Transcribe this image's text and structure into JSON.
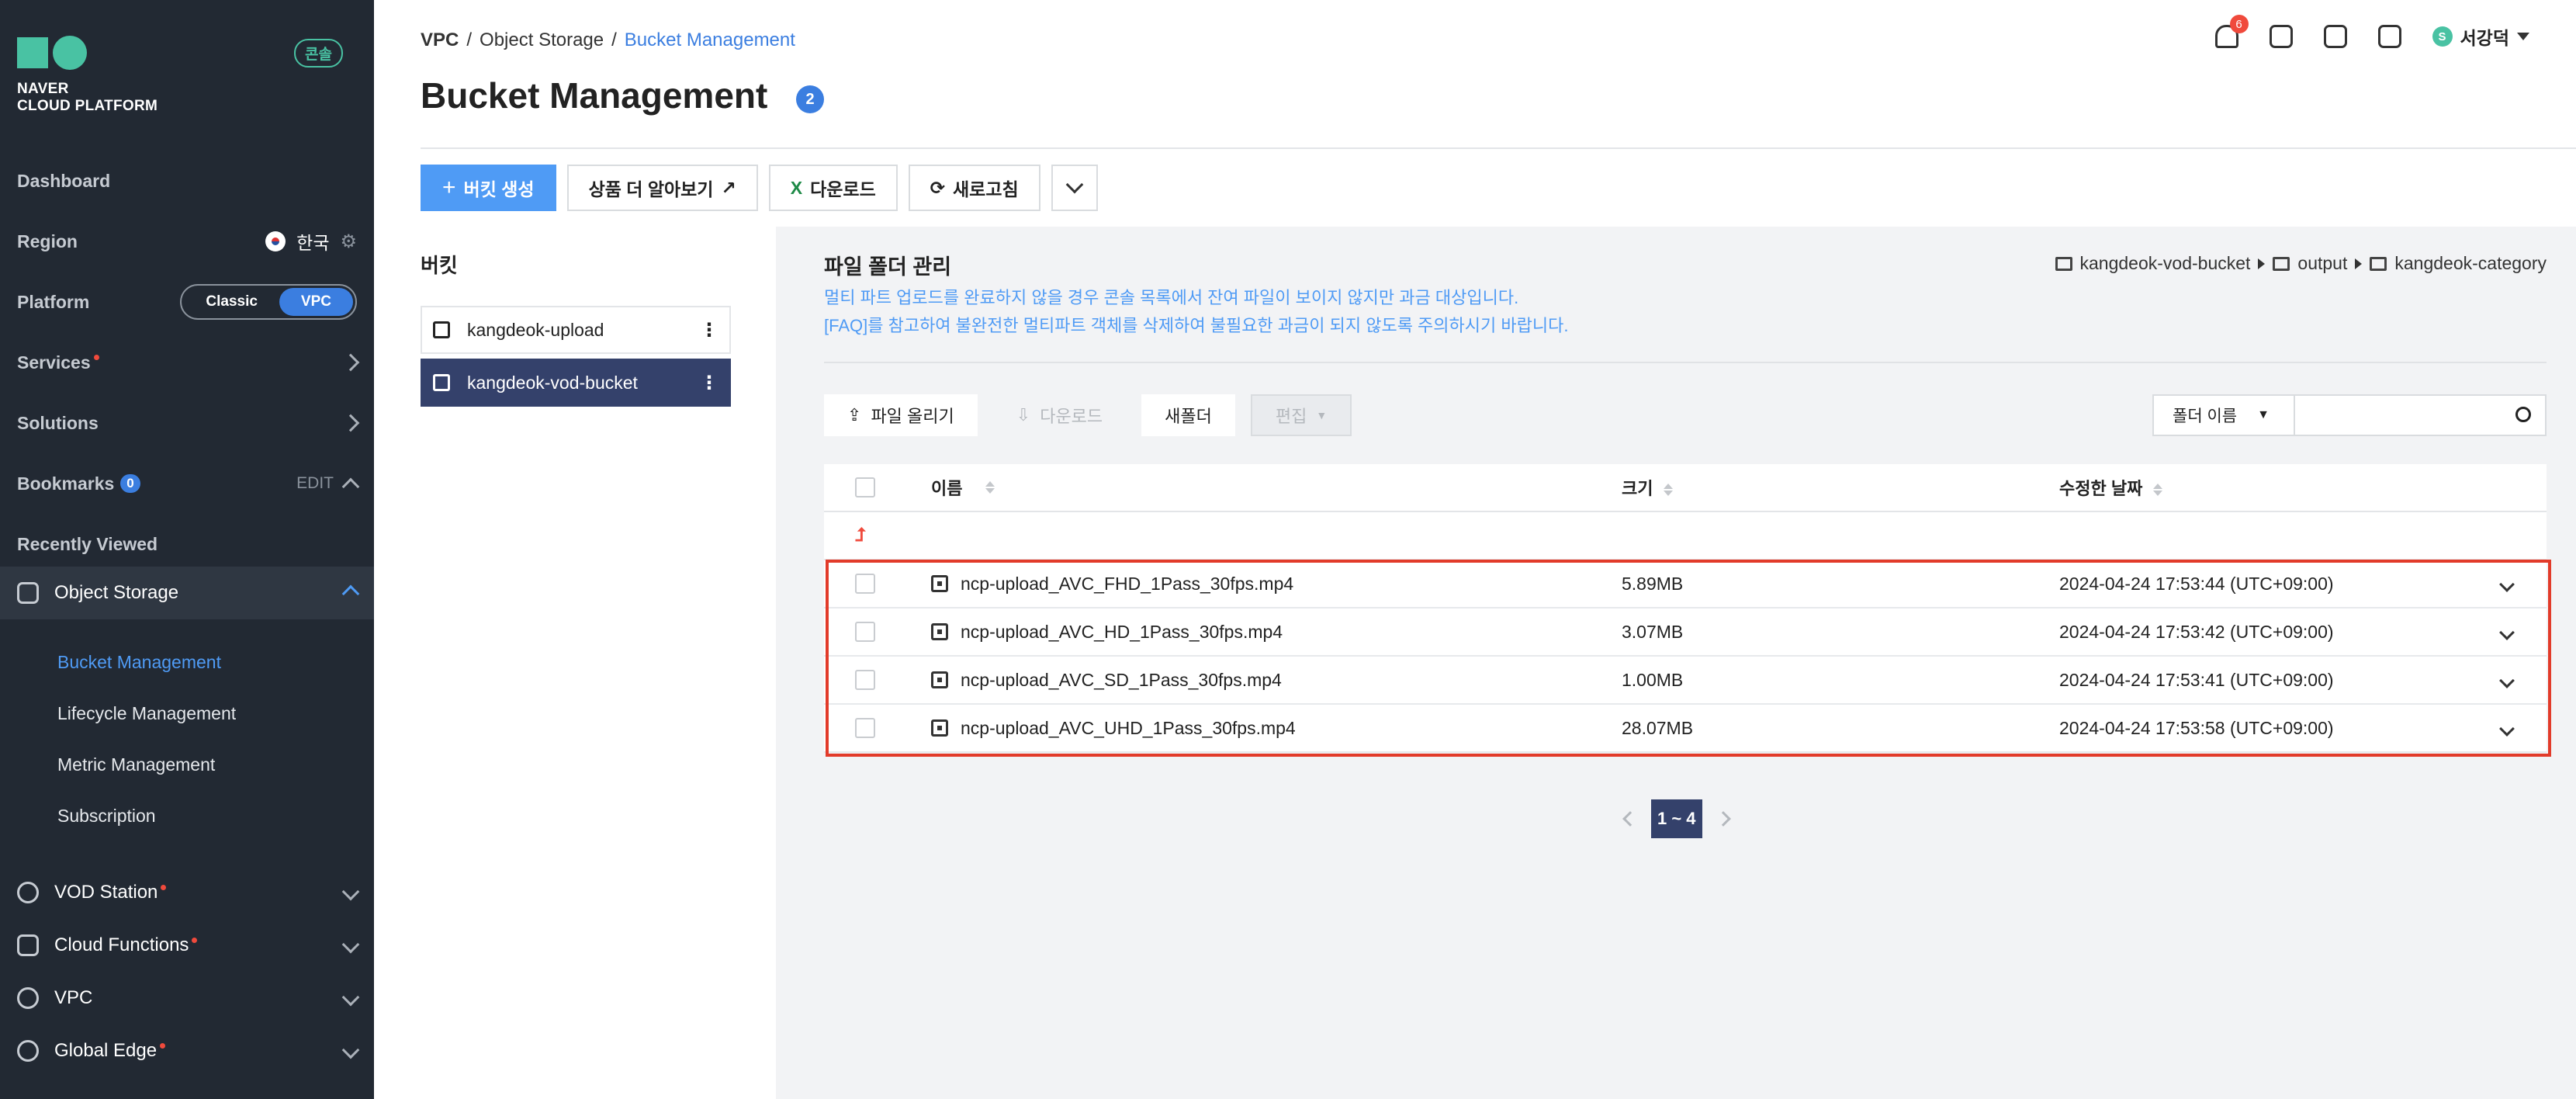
{
  "brand": {
    "line1": "NAVER",
    "line2": "CLOUD PLATFORM",
    "console_badge": "콘솔",
    "accent": "#49c2a3"
  },
  "sidebar": {
    "dashboard": "Dashboard",
    "region_label": "Region",
    "region_value": "한국",
    "platform_label": "Platform",
    "platform_options": [
      "Classic",
      "VPC"
    ],
    "platform_selected": "VPC",
    "services": "Services",
    "solutions": "Solutions",
    "bookmarks": "Bookmarks",
    "bookmarks_count": "0",
    "bookmarks_edit": "EDIT",
    "recently_viewed": "Recently Viewed",
    "active_section": "Object Storage",
    "sub_items": [
      "Bucket Management",
      "Lifecycle Management",
      "Metric Management",
      "Subscription"
    ],
    "bottom_items": [
      "VOD Station",
      "Cloud Functions",
      "VPC",
      "Global Edge"
    ]
  },
  "header": {
    "breadcrumb": [
      "VPC",
      "Object Storage",
      "Bucket Management"
    ],
    "title": "Bucket Management",
    "title_badge": "2",
    "notification_count": "6",
    "user_initial": "S",
    "user_name": "서강덕"
  },
  "toolbar": {
    "create": "버킷 생성",
    "learn_more": "상품 더 알아보기",
    "download": "다운로드",
    "refresh": "새로고침"
  },
  "buckets": {
    "heading": "버킷",
    "items": [
      "kangdeok-upload",
      "kangdeok-vod-bucket"
    ],
    "selected": "kangdeok-vod-bucket"
  },
  "files": {
    "title": "파일 폴더 관리",
    "notice1": "멀티 파트 업로드를 완료하지 않을 경우 콘솔 목록에서 잔여 파일이 보이지 않지만 과금 대상입니다.",
    "notice2": "[FAQ]를 참고하여 불완전한 멀티파트 객체를 삭제하여 불필요한 과금이 되지 않도록 주의하시기 바랍니다.",
    "path": [
      "kangdeok-vod-bucket",
      "output",
      "kangdeok-category"
    ],
    "upload_btn": "파일 올리기",
    "download_btn": "다운로드",
    "new_folder_btn": "새폴더",
    "edit_btn": "편집",
    "search_select": "폴더 이름",
    "columns": {
      "name": "이름",
      "size": "크기",
      "modified": "수정한 날짜"
    },
    "rows": [
      {
        "name": "ncp-upload_AVC_FHD_1Pass_30fps.mp4",
        "size": "5.89MB",
        "modified": "2024-04-24 17:53:44 (UTC+09:00)"
      },
      {
        "name": "ncp-upload_AVC_HD_1Pass_30fps.mp4",
        "size": "3.07MB",
        "modified": "2024-04-24 17:53:42 (UTC+09:00)"
      },
      {
        "name": "ncp-upload_AVC_SD_1Pass_30fps.mp4",
        "size": "1.00MB",
        "modified": "2024-04-24 17:53:41 (UTC+09:00)"
      },
      {
        "name": "ncp-upload_AVC_UHD_1Pass_30fps.mp4",
        "size": "28.07MB",
        "modified": "2024-04-24 17:53:58 (UTC+09:00)"
      }
    ],
    "pagination": "1 ~ 4"
  }
}
